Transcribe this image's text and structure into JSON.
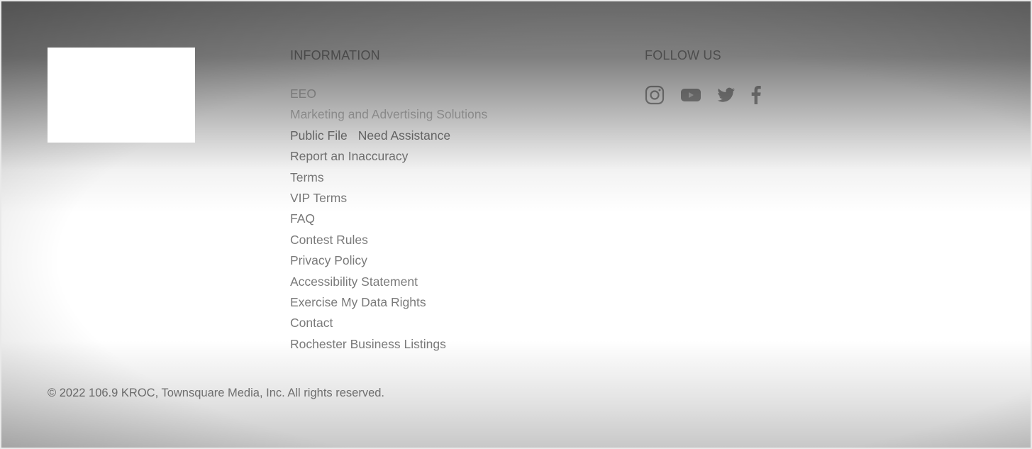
{
  "footer": {
    "information_heading": "INFORMATION",
    "follow_heading": "FOLLOW US",
    "links": [
      {
        "label": "EEO"
      },
      {
        "label": "Marketing and Advertising Solutions"
      },
      {
        "label": "Public File",
        "extra_label": "Need Assistance"
      },
      {
        "label": "Report an Inaccuracy"
      },
      {
        "label": "Terms"
      },
      {
        "label": "VIP Terms"
      },
      {
        "label": "FAQ"
      },
      {
        "label": "Contest Rules"
      },
      {
        "label": "Privacy Policy"
      },
      {
        "label": "Accessibility Statement"
      },
      {
        "label": "Exercise My Data Rights"
      },
      {
        "label": "Contact"
      },
      {
        "label": "Rochester Business Listings"
      }
    ],
    "social_icons": [
      "instagram-icon",
      "youtube-icon",
      "twitter-icon",
      "facebook-icon"
    ],
    "copyright": "© 2022 106.9 KROC, Townsquare Media, Inc. All rights reserved."
  },
  "colors": {
    "text": "#7a7a7a",
    "heading": "#9a9a9a",
    "background": "#ffffff"
  }
}
